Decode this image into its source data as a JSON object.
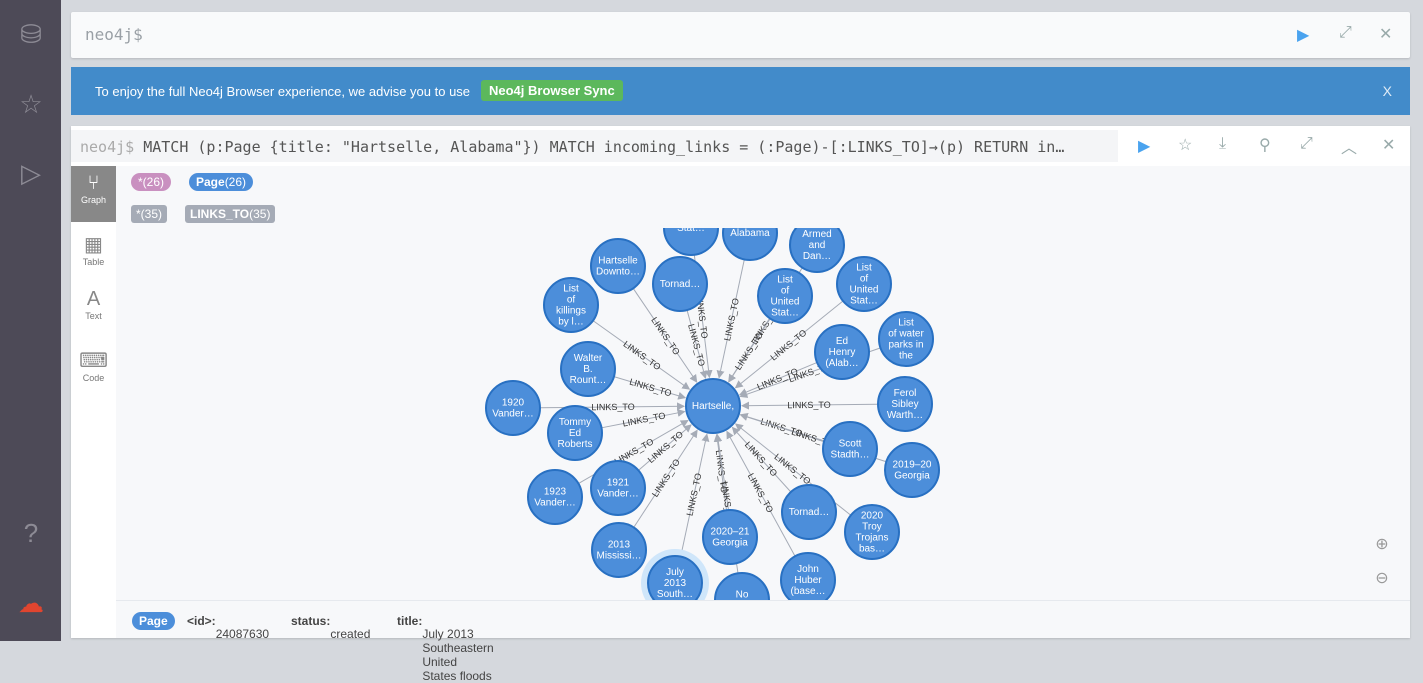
{
  "sidebar": {
    "items": [
      {
        "icon": "database-check-icon"
      },
      {
        "icon": "star-icon"
      },
      {
        "icon": "play-monitor-icon"
      },
      {
        "icon": "help-icon"
      },
      {
        "icon": "cloud-disconnected-icon"
      }
    ]
  },
  "editor": {
    "prompt": "neo4j$"
  },
  "banner": {
    "message": "To enjoy the full Neo4j Browser experience, we advise you to use",
    "button": "Neo4j Browser Sync",
    "close": "X"
  },
  "result": {
    "prompt": "neo4j$",
    "query": "MATCH (p:Page {title: \"Hartselle, Alabama\"}) MATCH incoming_links = (:Page)-[:LINKS_TO]→(p) RETURN in…",
    "tabs": [
      {
        "label": "Graph",
        "icon": "graph-icon"
      },
      {
        "label": "Table",
        "icon": "table-icon"
      },
      {
        "label": "Text",
        "icon": "text-icon"
      },
      {
        "label": "Code",
        "icon": "code-icon"
      }
    ],
    "node_labels": [
      {
        "name": "*",
        "count": "(26)",
        "color": "#c990c0"
      },
      {
        "name": "Page",
        "count": "(26)",
        "color": "#4c8eda"
      }
    ],
    "rel_types": [
      {
        "name": "*",
        "count": "(35)"
      },
      {
        "name": "LINKS_TO",
        "count": "(35)"
      }
    ],
    "edge_label": "LINKS_TO",
    "center": "Hartselle,",
    "nodes": [
      [
        "Stat…"
      ],
      [
        "Alabama"
      ],
      [
        "Armed",
        "and",
        "Dan…"
      ],
      [
        "Hartselle",
        "Downto…"
      ],
      [
        "Tornad…"
      ],
      [
        "List",
        "of",
        "United",
        "Stat…"
      ],
      [
        "List",
        "of",
        "United",
        "Stat…"
      ],
      [
        "List",
        "of",
        "killings",
        "by l…"
      ],
      [
        "List",
        "of water",
        "parks in",
        "the"
      ],
      [
        "Ed",
        "Henry",
        "(Alab…"
      ],
      [
        "Walter",
        "B.",
        "Rount…"
      ],
      [
        "1920",
        "Vander…"
      ],
      [
        "Ferol",
        "Sibley",
        "Warth…"
      ],
      [
        "Tommy",
        "Ed",
        "Roberts"
      ],
      [
        "Scott",
        "Stadth…"
      ],
      [
        "2019–20",
        "Georgia"
      ],
      [
        "1921",
        "Vander…"
      ],
      [
        "1923",
        "Vander…"
      ],
      [
        "Tornad…"
      ],
      [
        "2020",
        "Troy",
        "Trojans",
        "bas…"
      ],
      [
        "2013",
        "Mississi…"
      ],
      [
        "2020–21",
        "Georgia"
      ],
      [
        "July",
        "2013",
        "South…"
      ],
      [
        "No",
        "…"
      ],
      [
        "John",
        "Huber",
        "(base…"
      ]
    ],
    "node_color": "#4c8eda",
    "status": {
      "label": "Page",
      "id_key": "<id>:",
      "id": "24087630",
      "status_key": "status:",
      "status": "created",
      "title_key": "title:",
      "title": "July 2013 Southeastern United States floods"
    }
  }
}
